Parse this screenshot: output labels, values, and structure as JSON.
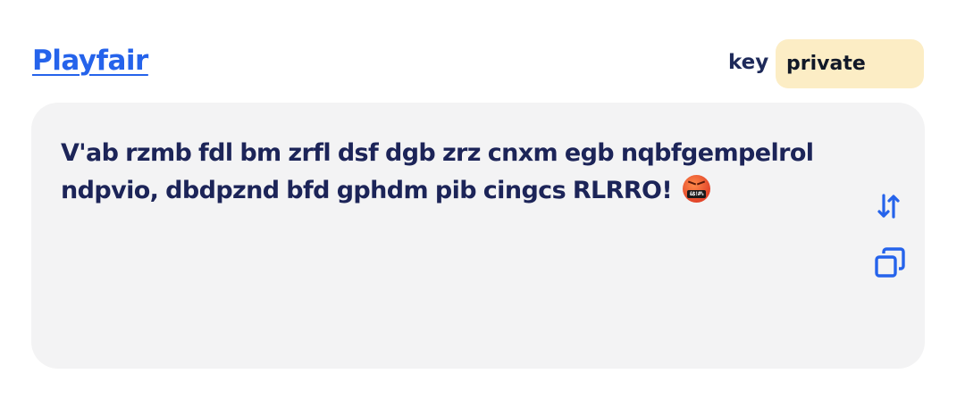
{
  "header": {
    "cipher_name": "Playfair",
    "key_label": "key",
    "key_value": "private"
  },
  "output": {
    "text": "V'ab rzmb fdl bm zrfl dsf dgb zrz cnxm egb nqbfgempelrol ndpvio, dbdpznd bfd gphdm pib cingcs RLRRO!",
    "emoji_mouth_text": "&$!#%"
  },
  "icons": {
    "swap": "swap-vertical-icon",
    "copy": "copy-icon"
  },
  "colors": {
    "accent": "#2563eb",
    "text": "#1c2458",
    "panel_bg": "#f3f3f4",
    "key_bg": "#fcedc5"
  }
}
